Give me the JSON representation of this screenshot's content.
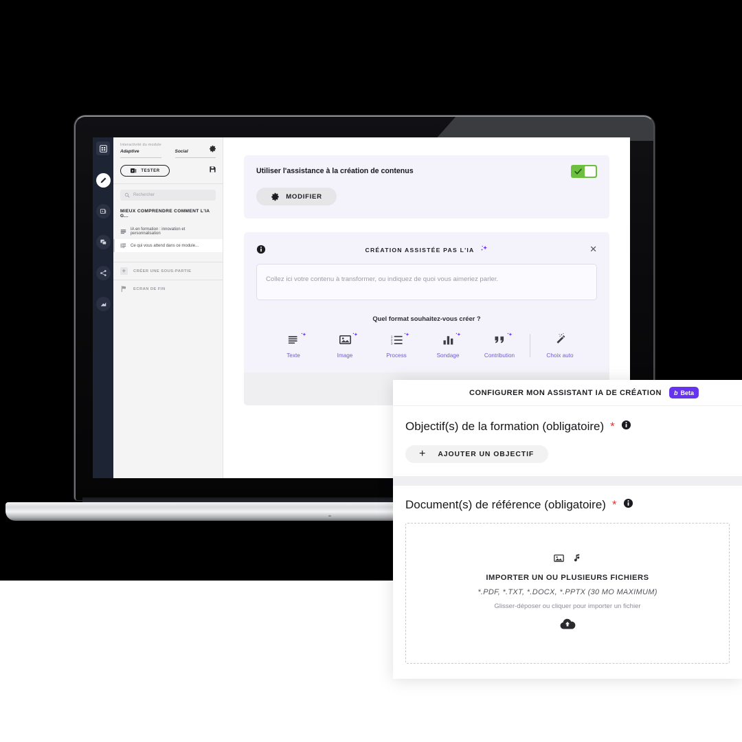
{
  "app": {
    "rail": {
      "logo_icon": "grid-logo-icon",
      "items": [
        {
          "name": "edit-tool",
          "icon": "pencil-icon",
          "active": true
        },
        {
          "name": "media-tool",
          "icon": "video-card-icon",
          "active": false
        },
        {
          "name": "duplicate-tool",
          "icon": "copy-icon",
          "active": false
        },
        {
          "name": "share-tool",
          "icon": "share-nodes-icon",
          "active": false
        },
        {
          "name": "stats-tool",
          "icon": "bar-chart-icon",
          "active": false
        }
      ]
    },
    "outline": {
      "interactivity_label": "Interactivité du module",
      "field_adaptive": "Adaptive",
      "field_social": "Social",
      "gear_icon": "gear-icon",
      "save_icon": "floppy-save-icon",
      "test_button": "TESTER",
      "test_icon": "play-card-icon",
      "search_placeholder": "Rechercher",
      "search_icon": "search-icon",
      "chapter_title": "MIEUX COMPRENDRE COMMENT L'IA G...",
      "items": [
        {
          "label": "IA en formation : innovation et personnalisation",
          "icon": "text-lines-icon",
          "selected": false
        },
        {
          "label": "Ce qui vous attend dans ce module...",
          "icon": "list-icon",
          "selected": true
        }
      ],
      "add_subpart": "CRÉER UNE SOUS-PARTIE",
      "add_icon": "plus-icon",
      "end_screen": "ECRAN DE FIN",
      "flag_icon": "flag-icon"
    },
    "assist_card": {
      "title": "Utiliser l'assistance à la création de contenus",
      "toggle_on": true,
      "toggle_icon": "check-icon",
      "toggle_color": "#6cbf3f",
      "modify_button": "MODIFIER",
      "modify_icon": "gear-icon"
    },
    "ai_card": {
      "info_icon": "info-icon",
      "title": "CRÉATION ASSISTÉE PAS L'IA",
      "sparkle_icon": "sparkle-icon",
      "close_icon": "close-icon",
      "input_placeholder": "Collez ici votre contenu à transformer, ou indiquez de quoi vous aimeriez parler.",
      "question": "Quel format souhaitez-vous créer ?",
      "formats": [
        {
          "label": "Texte",
          "icon": "text-lines-icon"
        },
        {
          "label": "Image",
          "icon": "image-icon"
        },
        {
          "label": "Process",
          "icon": "ordered-list-icon"
        },
        {
          "label": "Sondage",
          "icon": "bar-chart-icon"
        },
        {
          "label": "Contribution",
          "icon": "quote-icon"
        },
        {
          "label": "Choix auto",
          "icon": "magic-wand-icon"
        }
      ],
      "accent_color": "#6f5bd6"
    }
  },
  "panel": {
    "title": "CONFIGURER MON ASSISTANT IA DE CRÉATION",
    "badge": {
      "mark": "b",
      "label": "Beta",
      "color": "#6633ee"
    },
    "objective": {
      "label": "Objectif(s) de la formation (obligatoire)",
      "required_mark": "*",
      "info_icon": "info-icon",
      "add_button": "AJOUTER UN OBJECTIF",
      "add_icon": "plus-icon"
    },
    "documents": {
      "label": "Document(s) de référence (obligatoire)",
      "required_mark": "*",
      "info_icon": "info-icon",
      "dropzone": {
        "icons": [
          "image-icon",
          "music-note-icon"
        ],
        "title": "IMPORTER UN OU PLUSIEURS FICHIERS",
        "types": "*.PDF, *.TXT, *.DOCX, *.PPTX (30 MO MAXIMUM)",
        "hint": "Glisser-déposer ou cliquer pour importer un fichier",
        "cloud_icon": "cloud-upload-icon"
      }
    }
  }
}
